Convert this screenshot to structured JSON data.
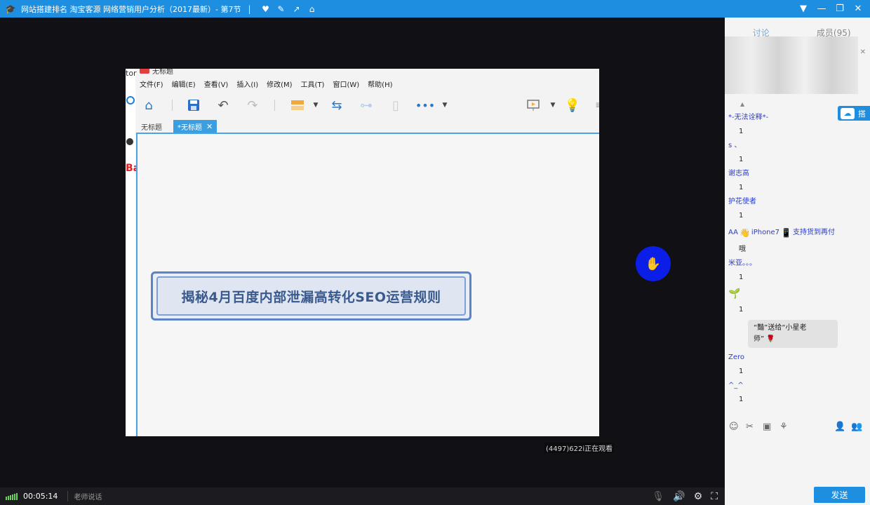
{
  "window": {
    "title": "网站搭建排名 淘宝客源 网络营销用户分析（2017最新）- 第7节",
    "separator": "|",
    "toolbar_icons": [
      "heart-icon",
      "edit-icon",
      "share-icon",
      "home-icon"
    ],
    "controls": {
      "menu": "▼",
      "minimize": "—",
      "restore": "❐",
      "close": "✕"
    }
  },
  "shared_app": {
    "title": "无标题",
    "menus": [
      "文件(F)",
      "编辑(E)",
      "查看(V)",
      "插入(I)",
      "修改(M)",
      "工具(T)",
      "窗口(W)",
      "帮助(H)"
    ],
    "tabs": [
      {
        "label": "无标题",
        "active": false
      },
      {
        "label": "*无标题",
        "active": true,
        "close": "✕"
      }
    ],
    "node_text": "揭秘4月百度内部泄漏高转化SEO运营规则",
    "left_strip": {
      "top_text": "tor",
      "red_text": "Ba"
    }
  },
  "watch_text": "(4497)622i正在观看",
  "bottom": {
    "time": "00:05:14",
    "status": "老师说话"
  },
  "panel": {
    "tabs": [
      {
        "label": "讨论",
        "active": true
      },
      {
        "label": "成员(95)",
        "active": false
      }
    ],
    "close": "✕",
    "dot": "▲",
    "share_label": "搭",
    "send_label": "发送",
    "messages": [
      {
        "name": "*-无法诠释*-",
        "body": "1"
      },
      {
        "name": "s 、",
        "body": "1"
      },
      {
        "name": "谢志高",
        "body": "1"
      },
      {
        "name": "护花使者",
        "body": "1"
      },
      {
        "name": "AA",
        "name_extra": "iPhone7",
        "name_extra2": "支持货到再付",
        "body": "哦"
      },
      {
        "name": "米亚。。。",
        "body": "1"
      },
      {
        "name": "",
        "body": "1",
        "plant": true
      }
    ],
    "gift": {
      "line1": "“豔”送给“小星老",
      "line2": "师”"
    },
    "messages2": [
      {
        "name": "Zero",
        "body": "1"
      },
      {
        "name": "^_^",
        "body": "1"
      }
    ]
  }
}
